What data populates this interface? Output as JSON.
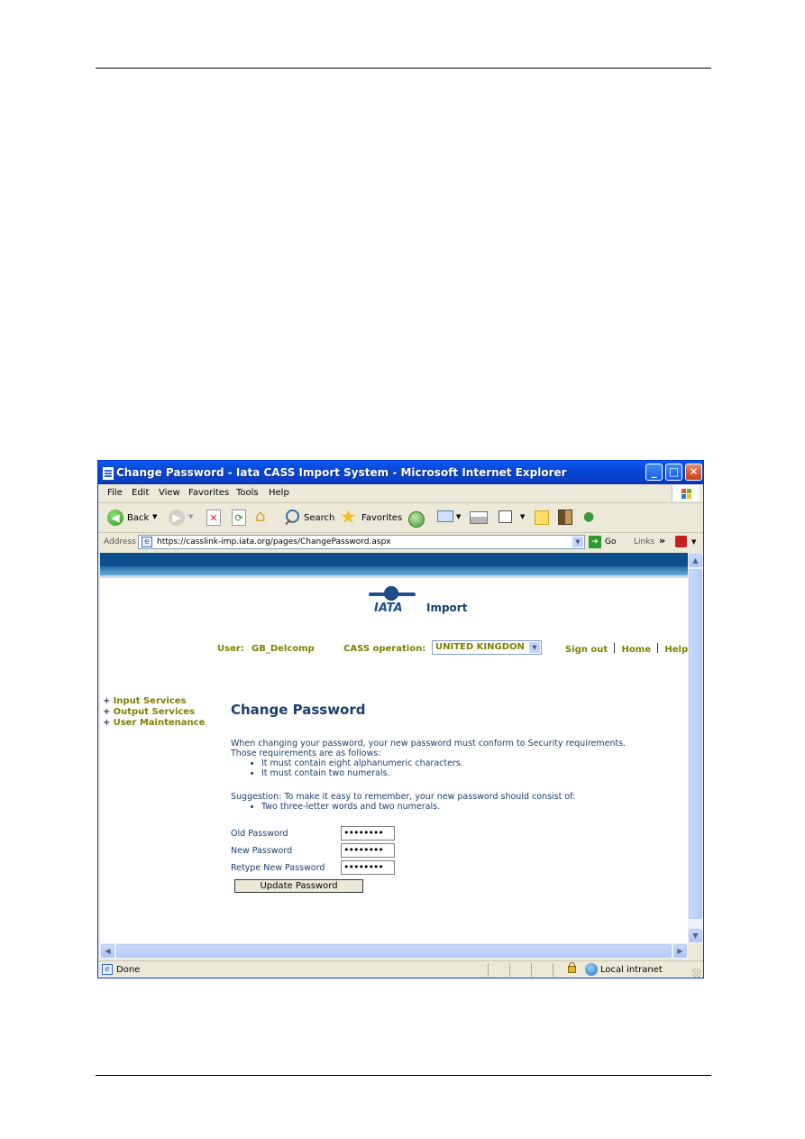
{
  "window": {
    "title": "Change Password - Iata CASS Import System - Microsoft Internet Explorer",
    "controls": {
      "minimize": "_",
      "maximize": "□",
      "close": "✕"
    }
  },
  "menu": [
    "File",
    "Edit",
    "View",
    "Favorites",
    "Tools",
    "Help"
  ],
  "toolbar": {
    "back": "Back",
    "search": "Search",
    "favorites": "Favorites"
  },
  "address": {
    "label": "Address",
    "url": "https://casslink-imp.iata.org/pages/ChangePassword.aspx",
    "go": "Go",
    "links": "Links",
    "chevron": "»"
  },
  "header": {
    "logo_text": "IATA",
    "app_name": "Import",
    "user_label": "User:",
    "user_value": "GB_Delcomp",
    "cass_label": "CASS operation:",
    "cass_value": "UNITED KINGDON",
    "nav": [
      "Sign out",
      "Home",
      "Help"
    ]
  },
  "sidebar": [
    {
      "marker": "+",
      "label": "Input Services"
    },
    {
      "marker": "+",
      "label": "Output Services"
    },
    {
      "marker": "+",
      "label": "User Maintenance"
    }
  ],
  "main": {
    "heading": "Change Password",
    "intro1": "When changing your password, your new password must conform to Security requirements.",
    "intro2": "Those requirements are as follows:",
    "requirements": [
      "It must contain eight alphanumeric characters.",
      "It must contain two numerals."
    ],
    "suggestion": "Suggestion: To make it easy to remember, your new password should consist of:",
    "suggestions": [
      "Two three-letter words and two numerals."
    ],
    "fields": [
      {
        "label": "Old Password",
        "value": "••••••••"
      },
      {
        "label": "New Password",
        "value": "••••••••"
      },
      {
        "label": "Retype New Password",
        "value": "••••••••"
      }
    ],
    "button": "Update Password"
  },
  "status": {
    "text": "Done",
    "zone": "Local intranet"
  }
}
